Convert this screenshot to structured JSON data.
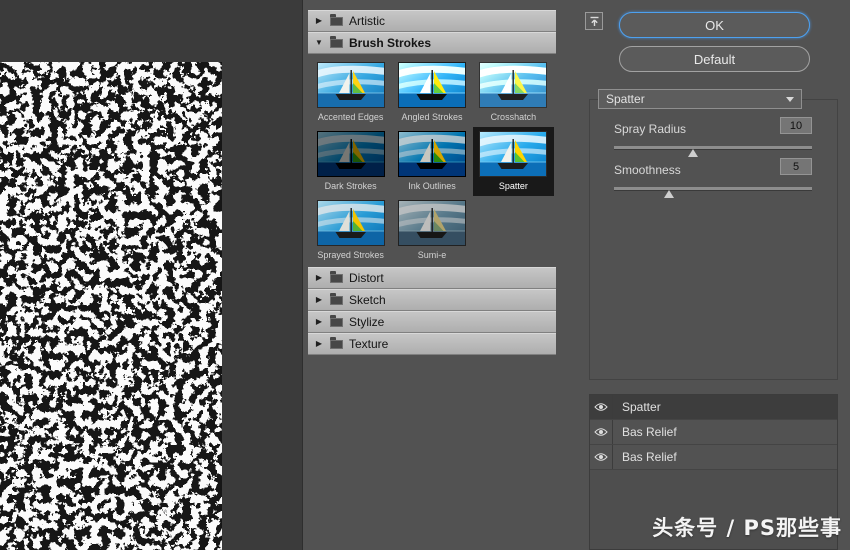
{
  "actions": {
    "ok": "OK",
    "default": "Default"
  },
  "settings": {
    "selected_filter": "Spatter",
    "params": [
      {
        "label": "Spray Radius",
        "value": "10"
      },
      {
        "label": "Smoothness",
        "value": "5"
      }
    ]
  },
  "categories": {
    "artistic": "Artistic",
    "brush_strokes": "Brush Strokes",
    "distort": "Distort",
    "sketch": "Sketch",
    "stylize": "Stylize",
    "texture": "Texture"
  },
  "thumbnails": {
    "items": [
      {
        "label": "Accented Edges"
      },
      {
        "label": "Angled Strokes"
      },
      {
        "label": "Crosshatch"
      },
      {
        "label": "Dark Strokes"
      },
      {
        "label": "Ink Outlines"
      },
      {
        "label": "Spatter",
        "selected": true
      },
      {
        "label": "Sprayed Strokes"
      },
      {
        "label": "Sumi-e"
      }
    ]
  },
  "effect_layers": {
    "items": [
      {
        "label": "Spatter",
        "selected": true
      },
      {
        "label": "Bas Relief"
      },
      {
        "label": "Bas Relief"
      }
    ]
  },
  "watermark": "头条号 / PS那些事",
  "colors": {
    "accent_blue": "#4da1f0",
    "list_row": "#b8b8b8",
    "ui_gray": "#525252"
  }
}
